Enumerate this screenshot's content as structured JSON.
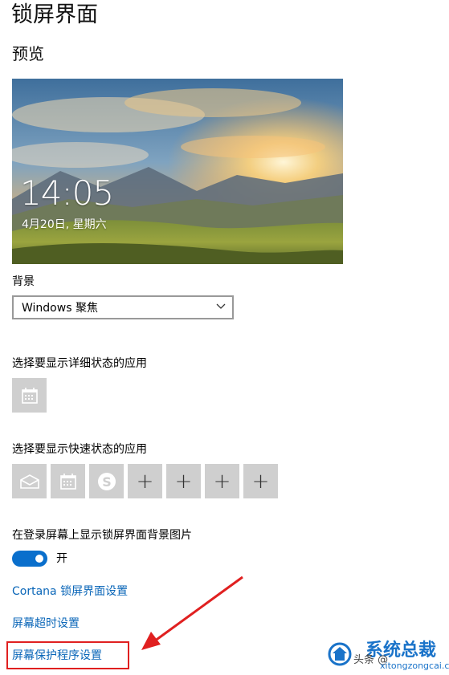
{
  "page": {
    "title": "锁屏界面",
    "preview_heading": "预览"
  },
  "preview": {
    "time": "14:05",
    "date": "4月20日, 星期六"
  },
  "background": {
    "label": "背景",
    "selected": "Windows 聚焦"
  },
  "detailed_status": {
    "label": "选择要显示详细状态的应用",
    "apps": [
      "calendar-icon"
    ]
  },
  "quick_status": {
    "label": "选择要显示快速状态的应用",
    "apps": [
      "mail-icon",
      "calendar-icon",
      "skype-icon",
      "add-icon",
      "add-icon",
      "add-icon",
      "add-icon"
    ],
    "add_glyph": "+"
  },
  "show_background": {
    "label": "在登录屏幕上显示锁屏界面背景图片",
    "state": "开"
  },
  "links": {
    "cortana": "Cortana 锁屏界面设置",
    "timeout": "屏幕超时设置",
    "screensaver": "屏幕保护程序设置"
  },
  "watermark": {
    "brand": "系统总裁",
    "site": "xitongzongcai.com",
    "prefix": "头条 @"
  },
  "colors": {
    "accent": "#0a6fcc",
    "link": "#0a66b8",
    "highlight": "#e02020"
  }
}
